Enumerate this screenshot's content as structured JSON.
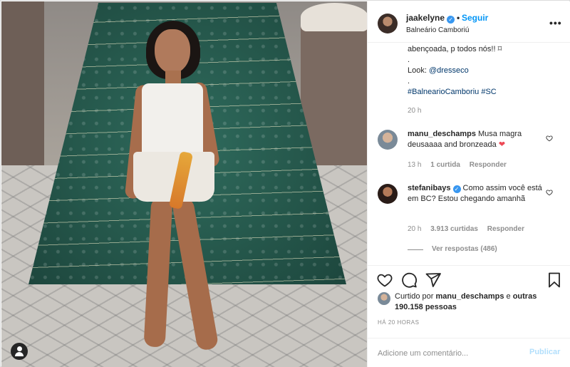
{
  "post": {
    "username": "jaakelyne",
    "verified_badge": "✓",
    "follow_label": "Seguir",
    "separator": "•",
    "location": "Balneário Camboriú",
    "more_icon": "more-options-icon",
    "more_label": "•••"
  },
  "caption": {
    "line1": "abençoada, p todos nós!! ",
    "line1_tail": "⌑",
    "dot1": ".",
    "look_prefix": "Look: ",
    "look_link": "@dresseco",
    "dot2": ".",
    "hashtag1": "#BalnearioCamboriu",
    "hashtag2": "#SC",
    "age": "20 h"
  },
  "comments": [
    {
      "username": "manu_deschamps",
      "text": "Musa magra deusaaaa and bronzeada",
      "emoji": "❤",
      "age": "13 h",
      "likes": "1 curtida",
      "reply_label": "Responder"
    },
    {
      "username": "stefanibays",
      "verified_badge": "✓",
      "text": "Como assim você está em BC? Estou chegando amanhã",
      "age": "20 h",
      "likes": "3.913 curtidas",
      "reply_label": "Responder",
      "view_replies": "Ver respostas (486)"
    }
  ],
  "actions": {
    "like_icon": "heart-icon",
    "comment_icon": "comment-icon",
    "share_icon": "share-icon",
    "save_icon": "bookmark-icon"
  },
  "likes": {
    "prefix": "Curtido por ",
    "user": "manu_deschamps",
    "middle": " e ",
    "others": "outras 190.158 pessoas"
  },
  "timestamp": "HÁ 20 HORAS",
  "comment_box": {
    "placeholder": "Adicione um comentário...",
    "publish_label": "Publicar"
  },
  "colors": {
    "accent": "#0095f6",
    "link": "#00376b",
    "muted": "#8e8e8e",
    "heart_red": "#ed4956",
    "verified": "#3897f0"
  }
}
